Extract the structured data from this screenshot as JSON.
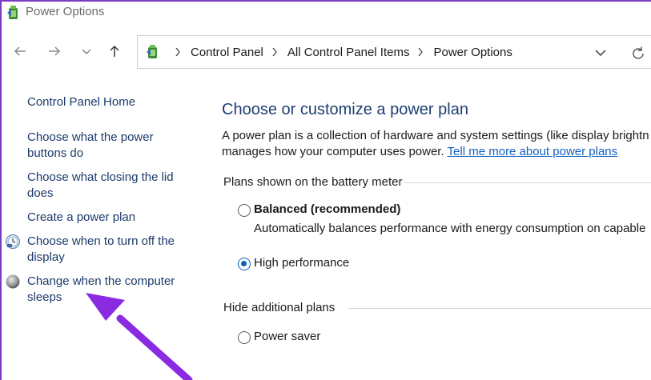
{
  "window": {
    "title": "Power Options",
    "icon": "power-options-icon"
  },
  "nav": {
    "back": "back-arrow-icon",
    "forward": "forward-arrow-icon",
    "recent": "chevron-down-icon",
    "up": "up-arrow-icon",
    "breadcrumbs": [
      "Control Panel",
      "All Control Panel Items",
      "Power Options"
    ],
    "refresh": "refresh-icon"
  },
  "sidebar": {
    "home": "Control Panel Home",
    "items": [
      {
        "line1": "Choose what the power",
        "line2": "buttons do",
        "icon": ""
      },
      {
        "line1": "Choose what closing the lid",
        "line2": "does",
        "icon": ""
      },
      {
        "line1": "Create a power plan",
        "line2": "",
        "icon": ""
      },
      {
        "line1": "Choose when to turn off the",
        "line2": "display",
        "icon": "display-clock-icon"
      },
      {
        "line1": "Change when the computer",
        "line2": "sleeps",
        "icon": "moon-sleep-icon"
      }
    ]
  },
  "main": {
    "heading": "Choose or customize a power plan",
    "intro_line1": "A power plan is a collection of hardware and system settings (like display brightn",
    "intro_line2_prefix": "manages how your computer uses power. ",
    "intro_link": "Tell me more about power plans",
    "battery_group": "Plans shown on the battery meter",
    "plans": [
      {
        "name": "Balanced (recommended)",
        "desc": "Automatically balances performance with energy consumption on capable",
        "selected": false
      },
      {
        "name": "High performance",
        "desc": "",
        "selected": true
      }
    ],
    "hidden_group": "Hide additional plans",
    "hidden_plans": [
      {
        "name": "Power saver",
        "selected": false
      }
    ]
  },
  "colors": {
    "accent": "#0a5fbf",
    "link": "#1060c0",
    "heading": "#1e3f73",
    "annotation_arrow": "#8a2be2"
  }
}
